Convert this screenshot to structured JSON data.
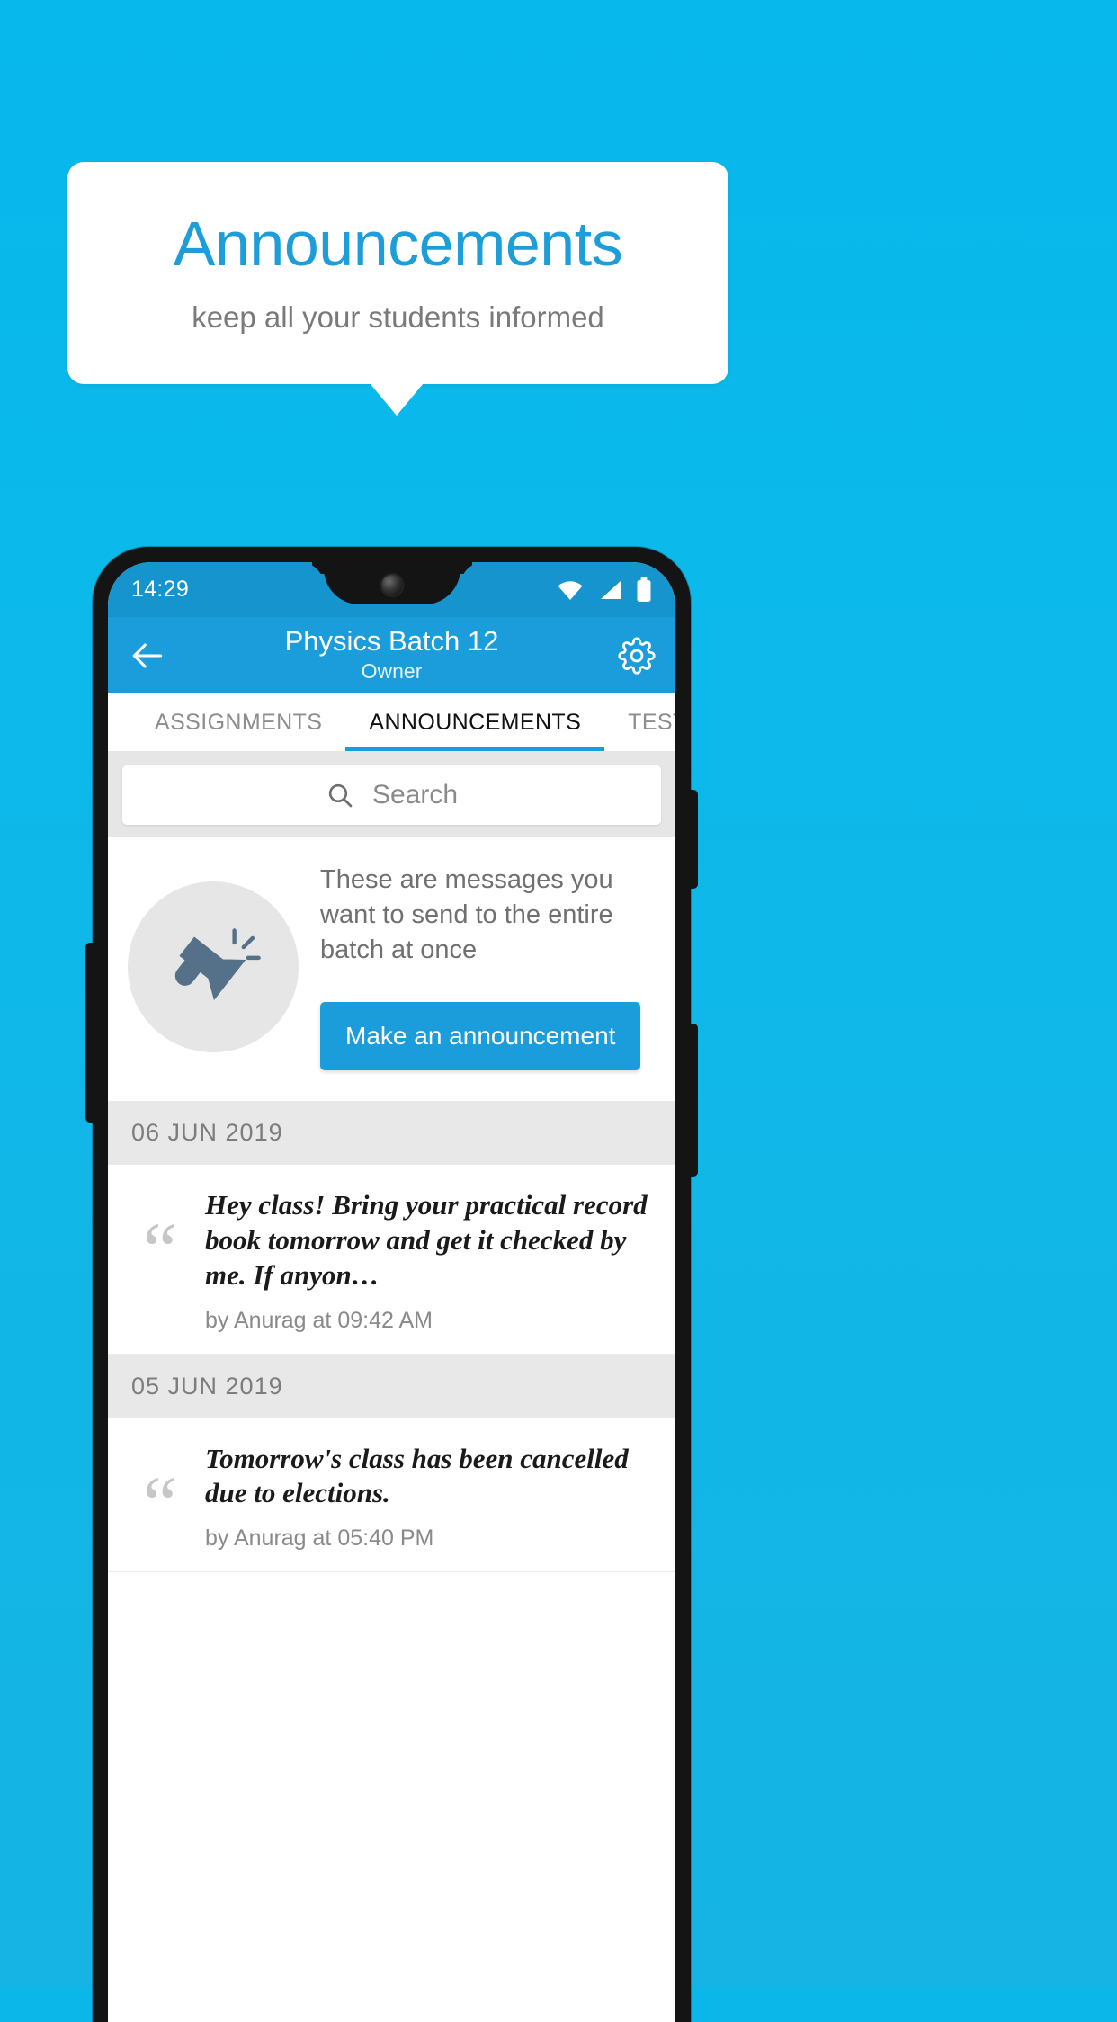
{
  "promo": {
    "title": "Announcements",
    "subtitle": "keep all your students informed"
  },
  "colors": {
    "background": "#0bb6e8",
    "accent": "#1b9ddb",
    "title_blue": "#1e9ed9",
    "statusbar": "#1594ce",
    "button": "#1b9ddb",
    "divider": "#e8e8e8"
  },
  "phone": {
    "status_bar": {
      "time": "14:29",
      "icons": [
        "wifi-icon",
        "signal-icon",
        "battery-icon"
      ]
    },
    "app_bar": {
      "back_label": "back-arrow-icon",
      "title": "Physics Batch 12",
      "subtitle": "Owner",
      "settings_label": "gear-icon"
    },
    "tabs": [
      {
        "label": "ASSIGNMENTS",
        "active": false
      },
      {
        "label": "ANNOUNCEMENTS",
        "active": true
      },
      {
        "label": "TESTS",
        "active": false
      },
      {
        "label": "’",
        "active": false
      }
    ],
    "search": {
      "placeholder": "Search",
      "value": "",
      "icon": "search-icon"
    },
    "promo_card": {
      "icon": "megaphone-icon",
      "description": "These are messages you want to send to the entire batch at once",
      "button_label": "Make an announcement"
    },
    "announcement_groups": [
      {
        "date": "06  JUN  2019",
        "items": [
          {
            "text": "Hey class! Bring your practical record book tomorrow and get it checked by me. If anyon…",
            "meta": "by Anurag at 09:42 AM"
          }
        ]
      },
      {
        "date": "05  JUN  2019",
        "items": [
          {
            "text": "Tomorrow's class has been cancelled due to elections.",
            "meta": "by Anurag at 05:40 PM"
          }
        ]
      }
    ]
  }
}
